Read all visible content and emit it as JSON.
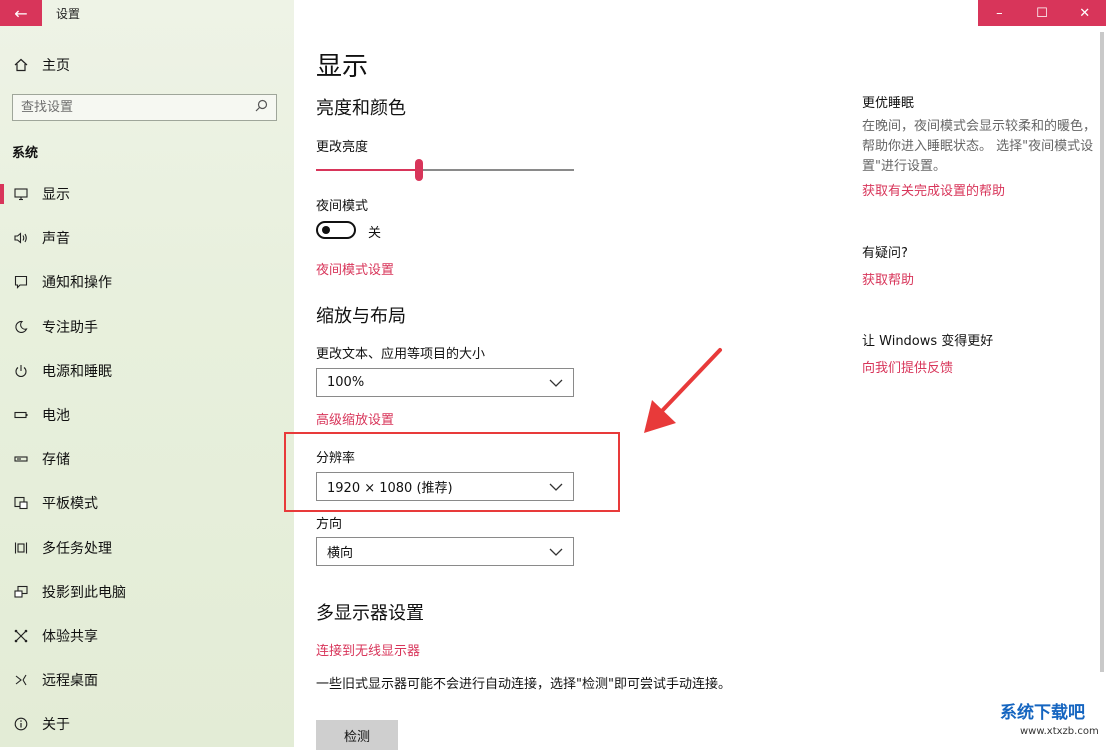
{
  "window": {
    "title": "设置",
    "controls": {
      "minimize": "–",
      "maximize": "☐",
      "close": "✕"
    }
  },
  "sidebar": {
    "home_label": "主页",
    "search_placeholder": "查找设置",
    "section_header": "系统",
    "items": [
      {
        "label": "显示",
        "icon": "monitor-icon",
        "active": true
      },
      {
        "label": "声音",
        "icon": "speaker-icon"
      },
      {
        "label": "通知和操作",
        "icon": "notification-icon"
      },
      {
        "label": "专注助手",
        "icon": "moon-icon"
      },
      {
        "label": "电源和睡眠",
        "icon": "power-icon"
      },
      {
        "label": "电池",
        "icon": "battery-icon"
      },
      {
        "label": "存储",
        "icon": "storage-icon"
      },
      {
        "label": "平板模式",
        "icon": "tablet-icon"
      },
      {
        "label": "多任务处理",
        "icon": "multitask-icon"
      },
      {
        "label": "投影到此电脑",
        "icon": "project-icon"
      },
      {
        "label": "体验共享",
        "icon": "share-icon"
      },
      {
        "label": "远程桌面",
        "icon": "remote-icon"
      },
      {
        "label": "关于",
        "icon": "info-icon"
      }
    ]
  },
  "main": {
    "title": "显示",
    "brightness_section": {
      "heading": "亮度和颜色",
      "brightness_label": "更改亮度",
      "brightness_value": 0.4,
      "night_mode_label": "夜间模式",
      "night_mode_state": "关",
      "night_mode_settings_link": "夜间模式设置"
    },
    "layout_section": {
      "heading": "缩放与布局",
      "scale_label": "更改文本、应用等项目的大小",
      "scale_value": "100%",
      "advanced_scaling_link": "高级缩放设置",
      "resolution_label": "分辨率",
      "resolution_value": "1920 × 1080 (推荐)",
      "orientation_label": "方向",
      "orientation_value": "横向"
    },
    "multi_display_section": {
      "heading": "多显示器设置",
      "wireless_link": "连接到无线显示器",
      "description": "一些旧式显示器可能不会进行自动连接，选择\"检测\"即可尝试手动连接。",
      "detect_button": "检测"
    }
  },
  "right_column": {
    "sleep": {
      "title": "更优睡眠",
      "text": "在晚间，夜间模式会显示较柔和的暖色，帮助你进入睡眠状态。 选择\"夜间模式设置\"进行设置。",
      "link": "获取有关完成设置的帮助"
    },
    "question": {
      "title": "有疑问?",
      "link": "获取帮助"
    },
    "feedback": {
      "title": "让 Windows 变得更好",
      "link": "向我们提供反馈"
    }
  },
  "watermark": {
    "main": "系统下载吧",
    "sub": "www.xtxzb.com"
  },
  "colors": {
    "accent": "#d8355a",
    "annotation": "#e83a3a",
    "watermark": "#1565c0"
  }
}
